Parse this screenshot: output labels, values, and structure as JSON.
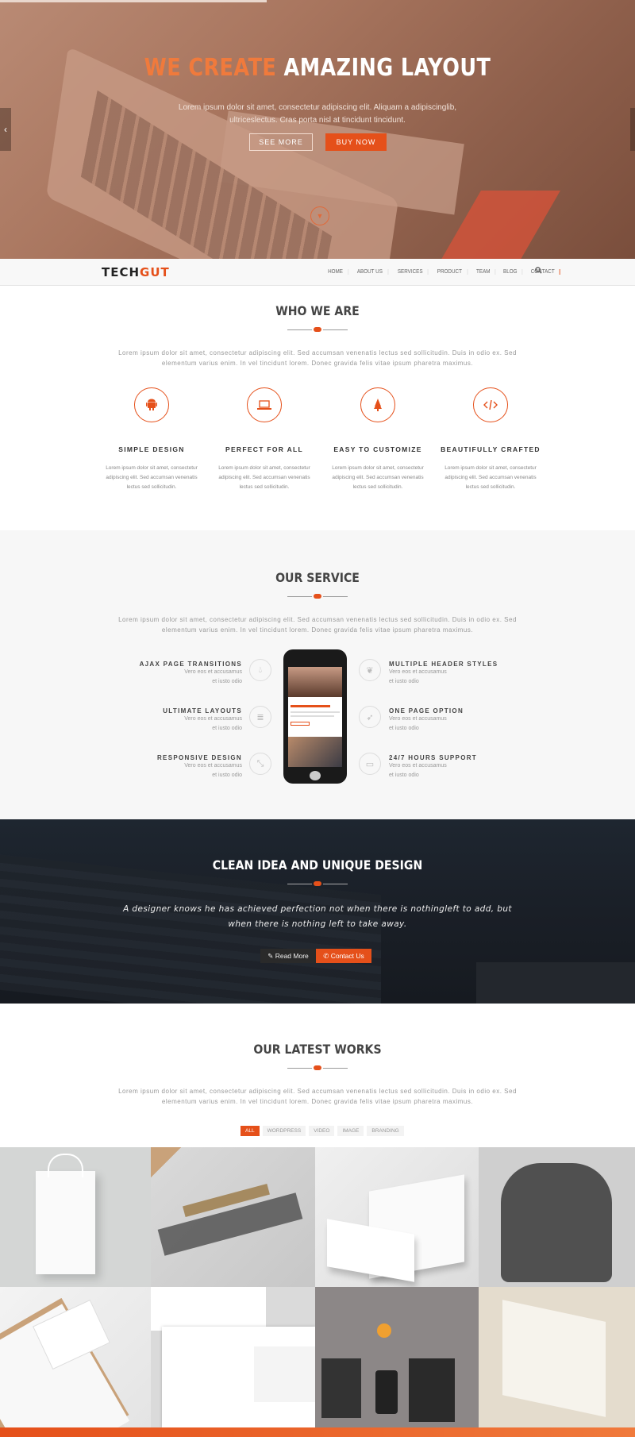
{
  "hero": {
    "title_accent": "WE CREATE",
    "title_rest": "AMAZING LAYOUT",
    "subtitle": "Lorem ipsum dolor sit amet, consectetur adipiscing elit. Aliquam a adipiscinglib, ultriceslectus. Cras porta nisl at tincidunt tincidunt.",
    "see_more": "SEE MORE",
    "buy_now": "BUY NOW",
    "prev_icon": "‹",
    "down_icon": "▼"
  },
  "nav": {
    "logo_a": "TECH",
    "logo_b": "GUT",
    "items": [
      "HOME",
      "ABOUT US",
      "SERVICES",
      "PRODUCT",
      "TEAM",
      "BLOG",
      "CONTACT"
    ],
    "search_icon": "search-icon"
  },
  "who": {
    "title": "WHO WE ARE",
    "text": "Lorem ipsum dolor sit amet, consectetur adipiscing elit. Sed accumsan venenatis lectus sed sollicitudin. Duis in odio ex. Sed elementum varius enim. In vel tincidunt lorem. Donec gravida felis vitae ipsum pharetra maximus.",
    "features": [
      {
        "icon": "android-icon",
        "title": "SIMPLE DESIGN",
        "text": "Lorem ipsum dolor sit amet, consectetur adipiscing elit. Sed accumsan venenatis lectus sed sollicitudin."
      },
      {
        "icon": "laptop-icon",
        "title": "PERFECT FOR ALL",
        "text": "Lorem ipsum dolor sit amet, consectetur adipiscing elit. Sed accumsan venenatis lectus sed sollicitudin."
      },
      {
        "icon": "tree-icon",
        "title": "EASY TO CUSTOMIZE",
        "text": "Lorem ipsum dolor sit amet, consectetur adipiscing elit. Sed accumsan venenatis lectus sed sollicitudin."
      },
      {
        "icon": "code-icon",
        "title": "BEAUTIFULLY CRAFTED",
        "text": "Lorem ipsum dolor sit amet, consectetur adipiscing elit. Sed accumsan venenatis lectus sed sollicitudin."
      }
    ]
  },
  "service": {
    "title": "OUR SERVICE",
    "text": "Lorem ipsum dolor sit amet, consectetur adipiscing elit. Sed accumsan venenatis lectus sed sollicitudin. Duis in odio ex. Sed elementum varius enim. In vel tincidunt lorem. Donec gravida felis vitae ipsum pharetra maximus.",
    "left": [
      {
        "icon": "drop-icon",
        "title": "AJAX PAGE TRANSITIONS",
        "text": "Vero eos et accusamus et iusto odio"
      },
      {
        "icon": "database-icon",
        "title": "ULTIMATE LAYOUTS",
        "text": "Vero eos et accusamus et iusto odio"
      },
      {
        "icon": "compress-icon",
        "title": "RESPONSIVE DESIGN",
        "text": "Vero eos et accusamus et iusto odio"
      }
    ],
    "right": [
      {
        "icon": "leaf-icon",
        "title": "MULTIPLE HEADER STYLES",
        "text": "Vero eos et accusamus et iusto odio"
      },
      {
        "icon": "rocket-icon",
        "title": "ONE PAGE OPTION",
        "text": "Vero eos et accusamus et iusto odio"
      },
      {
        "icon": "laptop-icon",
        "title": "24/7 HOURS SUPPORT",
        "text": "Vero eos et accusamus et iusto odio"
      }
    ]
  },
  "cta": {
    "title": "CLEAN IDEA AND UNIQUE DESIGN",
    "quote": "A designer knows he has achieved perfection not when there is nothingleft to add, but when there is nothing left to take away.",
    "read_more": "Read More",
    "contact": "Contact Us"
  },
  "works": {
    "title": "OUR LATEST WORKS",
    "text": "Lorem ipsum dolor sit amet, consectetur adipiscing elit. Sed accumsan venenatis lectus sed sollicitudin. Duis in odio ex. Sed elementum varius enim. In vel tincidunt lorem. Donec gravida felis vitae ipsum pharetra maximus.",
    "filters": [
      "ALL",
      "WORDPRESS",
      "VIDEO",
      "IMAGE",
      "BRANDING"
    ],
    "active_filter": "ALL"
  },
  "colors": {
    "accent": "#e5501a",
    "dark": "#1c222b",
    "light_bg": "#f7f7f7"
  }
}
